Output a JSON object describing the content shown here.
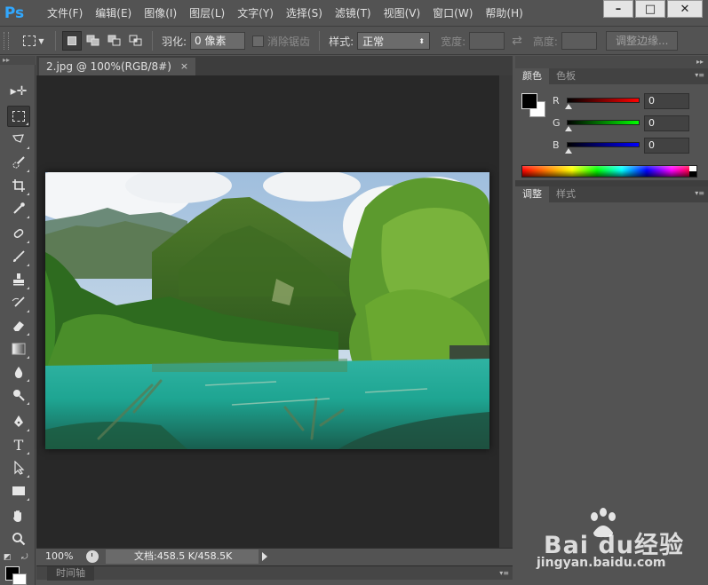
{
  "app": {
    "logo": "Ps"
  },
  "menu": [
    "文件(F)",
    "编辑(E)",
    "图像(I)",
    "图层(L)",
    "文字(Y)",
    "选择(S)",
    "滤镜(T)",
    "视图(V)",
    "窗口(W)",
    "帮助(H)"
  ],
  "window_controls": {
    "minimize": "–",
    "maximize": "□",
    "close": "✕"
  },
  "options": {
    "feather_label": "羽化:",
    "feather_value": "0 像素",
    "antialias_label": "消除锯齿",
    "style_label": "样式:",
    "style_value": "正常",
    "width_label": "宽度:",
    "height_label": "高度:",
    "refine_edge": "调整边缘..."
  },
  "document": {
    "tab_title": "2.jpg @ 100%(RGB/8#)",
    "tab_close": "×",
    "zoom": "100%",
    "doc_info": "文档:458.5 K/458.5K"
  },
  "timeline": {
    "label": "时间轴"
  },
  "color_panel": {
    "tabs": [
      "颜色",
      "色板"
    ],
    "channels": [
      {
        "label": "R",
        "value": "0",
        "color": "#ff0000"
      },
      {
        "label": "G",
        "value": "0",
        "color": "#00ff00"
      },
      {
        "label": "B",
        "value": "0",
        "color": "#0000ff"
      }
    ],
    "foreground": "#000000",
    "background": "#ffffff"
  },
  "adjust_panel": {
    "tabs": [
      "调整",
      "样式"
    ]
  },
  "watermark": {
    "brand": "Bai du经验",
    "url": "jingyan.baidu.com"
  },
  "tools": [
    "move-tool",
    "rectangular-marquee-tool",
    "lasso-tool",
    "quick-selection-tool",
    "crop-tool",
    "eyedropper-tool",
    "spot-healing-tool",
    "brush-tool",
    "clone-stamp-tool",
    "history-brush-tool",
    "eraser-tool",
    "gradient-tool",
    "blur-tool",
    "dodge-tool",
    "pen-tool",
    "type-tool",
    "path-selection-tool",
    "rectangle-tool",
    "hand-tool",
    "zoom-tool"
  ]
}
